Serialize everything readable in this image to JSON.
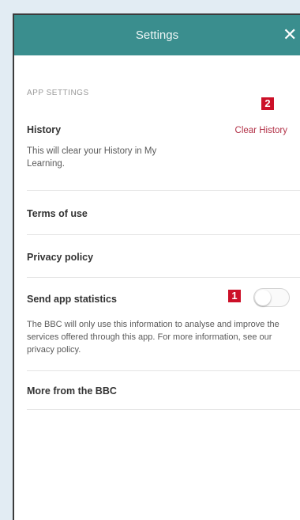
{
  "header": {
    "title": "Settings",
    "close_label": "✕"
  },
  "app_settings": {
    "section_label": "APP SETTINGS",
    "history": {
      "title": "History",
      "description": "This will clear your History in My Learning.",
      "action_label": "Clear History"
    },
    "terms": {
      "title": "Terms of use"
    },
    "privacy": {
      "title": "Privacy policy"
    },
    "statistics": {
      "title": "Send app statistics",
      "description": "The BBC will only use this information to analyse and improve the services offered through this app. For more information, see our privacy policy.",
      "toggle_on": false
    },
    "more": {
      "title": "More from the BBC"
    }
  },
  "callouts": {
    "toggle_badge": "1",
    "clear_badge": "2"
  },
  "colors": {
    "header": "#3a8e8e",
    "accent": "#b23147",
    "badge": "#cc1028"
  }
}
